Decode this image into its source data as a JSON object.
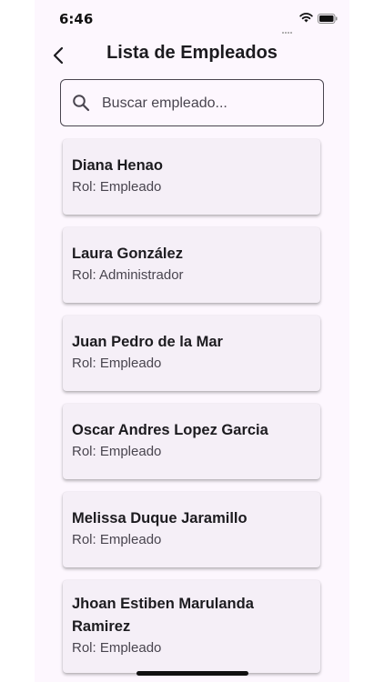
{
  "status_bar": {
    "time": "6:46"
  },
  "header": {
    "title": "Lista de Empleados"
  },
  "search": {
    "placeholder": "Buscar empleado...",
    "value": ""
  },
  "employees": [
    {
      "name": "Diana Henao",
      "role": "Rol: Empleado"
    },
    {
      "name": "Laura González",
      "role": "Rol: Administrador"
    },
    {
      "name": "Juan Pedro de la Mar",
      "role": "Rol: Empleado"
    },
    {
      "name": "Oscar Andres Lopez Garcia",
      "role": "Rol: Empleado"
    },
    {
      "name": "Melissa Duque Jaramillo",
      "role": "Rol: Empleado"
    },
    {
      "name": "Jhoan Estiben Marulanda Ramirez",
      "role": "Rol: Empleado"
    }
  ]
}
